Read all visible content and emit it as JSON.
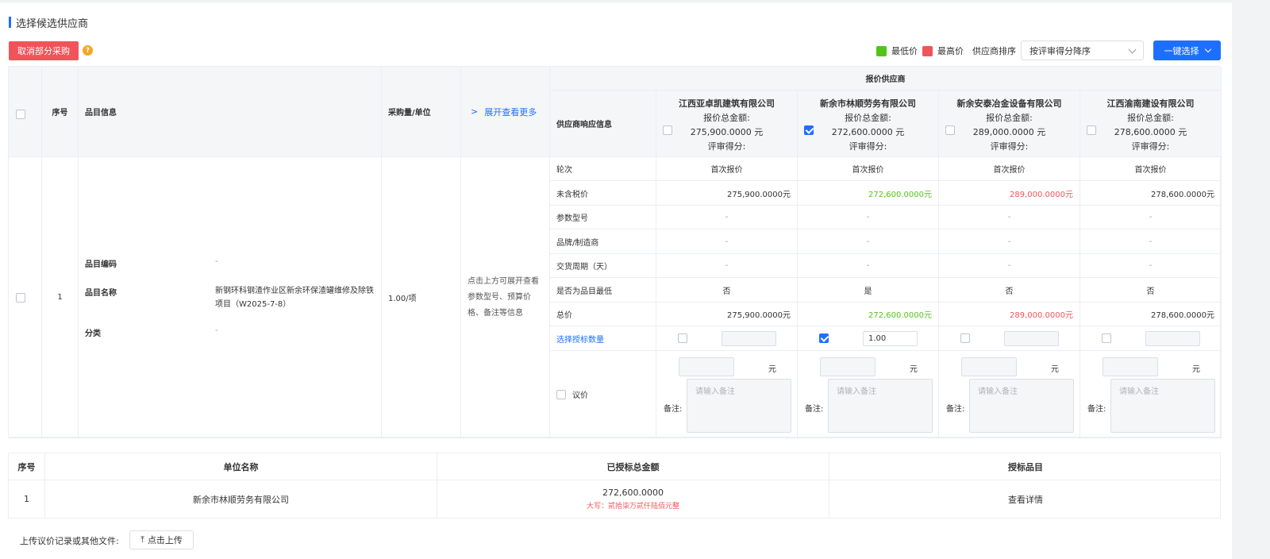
{
  "section_title": "选择候选供应商",
  "toolbar": {
    "cancel_label": "取消部分采购",
    "help_icon": "?",
    "legend_low": "最低价",
    "legend_high": "最高价",
    "legend_low_color": "#52c41a",
    "legend_high_color": "#f0545a",
    "sort_label": "供应商排序",
    "sort_value": "按评审得分降序",
    "onekey_label": "一键选择"
  },
  "table": {
    "headers": {
      "seq": "序号",
      "item_info": "品目信息",
      "qty_unit": "采购量/单位",
      "expand": "展开查看更多",
      "quote_suppliers": "报价供应商",
      "resp_info": "供应商响应信息"
    },
    "suppliers": [
      {
        "name": "江西亚卓凯建筑有限公司",
        "total_label": "报价总金额:",
        "total": "275,900.0000 元",
        "score_label": "评审得分:",
        "checked": false,
        "round": "首次报价",
        "pretax": "275,900.0000元",
        "param": "-",
        "brand": "-",
        "delivery": "-",
        "lowest": "否",
        "total_price": "275,900.0000元",
        "award_qty": "",
        "yuan": "元",
        "remark_label": "备注:",
        "remark_placeholder": "请输入备注"
      },
      {
        "name": "新余市林顺劳务有限公司",
        "total_label": "报价总金额:",
        "total": "272,600.0000 元",
        "score_label": "评审得分:",
        "checked": true,
        "round": "首次报价",
        "pretax": "272,600.0000元",
        "param": "-",
        "brand": "-",
        "delivery": "-",
        "lowest": "是",
        "total_price": "272,600.0000元",
        "award_qty": "1.00",
        "yuan": "元",
        "remark_label": "备注:",
        "remark_placeholder": "请输入备注"
      },
      {
        "name": "新余安泰冶金设备有限公司",
        "total_label": "报价总金额:",
        "total": "289,000.0000 元",
        "score_label": "评审得分:",
        "checked": false,
        "round": "首次报价",
        "pretax": "289,000.0000元",
        "param": "-",
        "brand": "-",
        "delivery": "-",
        "lowest": "否",
        "total_price": "289,000.0000元",
        "award_qty": "",
        "yuan": "元",
        "remark_label": "备注:",
        "remark_placeholder": "请输入备注"
      },
      {
        "name": "江西渝南建设有限公司",
        "total_label": "报价总金额:",
        "total": "278,600.0000 元",
        "score_label": "评审得分:",
        "checked": false,
        "round": "首次报价",
        "pretax": "278,600.0000元",
        "param": "-",
        "brand": "-",
        "delivery": "-",
        "lowest": "否",
        "total_price": "278,600.0000元",
        "award_qty": "",
        "yuan": "元",
        "remark_label": "备注:",
        "remark_placeholder": "请输入备注"
      }
    ],
    "row_labels": [
      "轮次",
      "未含税价",
      "参数型号",
      "品牌/制造商",
      "交货周期（天）",
      "是否为品目最低",
      "总价",
      "选择授标数量"
    ],
    "negotiate_label": "议价",
    "row": {
      "seq": "1",
      "code_label": "品目编码",
      "code_value": "-",
      "name_label": "品目名称",
      "name_value": "新钢环科钢渣作业区新余环保渣罐维修及除铁项目（W2025-7-8）",
      "category_label": "分类",
      "category_value": "-",
      "qty": "1.00/项",
      "expand_hint": "点击上方可展开查看参数型号、预算价格、备注等信息"
    }
  },
  "summary": {
    "headers": [
      "序号",
      "单位名称",
      "已授标总金额",
      "授标品目"
    ],
    "rows": [
      {
        "seq": "1",
        "company": "新余市林顺劳务有限公司",
        "amount": "272,600.0000",
        "amount_words": "大写：贰拾柒万贰仟陆佰元整",
        "detail_link": "查看详情"
      }
    ]
  },
  "upload": {
    "label": "上传议价记录或其他文件:",
    "button": "点击上传"
  }
}
